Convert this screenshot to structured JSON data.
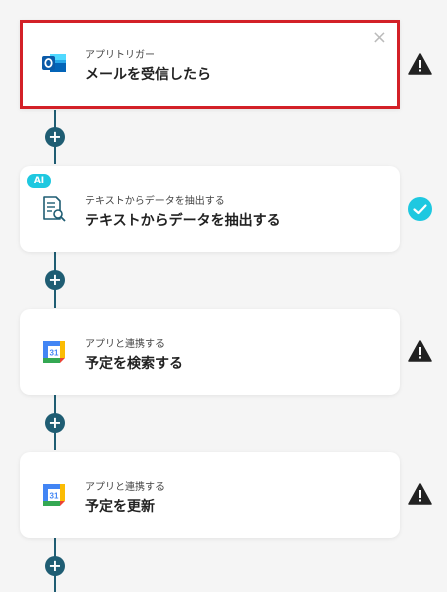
{
  "steps": [
    {
      "sub": "アプリトリガー",
      "title": "メールを受信したら",
      "icon": "outlook-icon",
      "status": "warning"
    },
    {
      "sub": "テキストからデータを抽出する",
      "title": "テキストからデータを抽出する",
      "icon": "document-search-icon",
      "status": "complete",
      "badge": "AI"
    },
    {
      "sub": "アプリと連携する",
      "title": "予定を検索する",
      "icon": "google-calendar-icon",
      "status": "warning"
    },
    {
      "sub": "アプリと連携する",
      "title": "予定を更新",
      "icon": "google-calendar-icon",
      "status": "warning"
    }
  ],
  "calendar_day": "31",
  "close_symbol": "×",
  "plus_symbol": "+",
  "colors": {
    "connector": "#1f5d73",
    "selected_border": "#d32027",
    "check": "#1ec8e0",
    "warning": "#222222"
  }
}
